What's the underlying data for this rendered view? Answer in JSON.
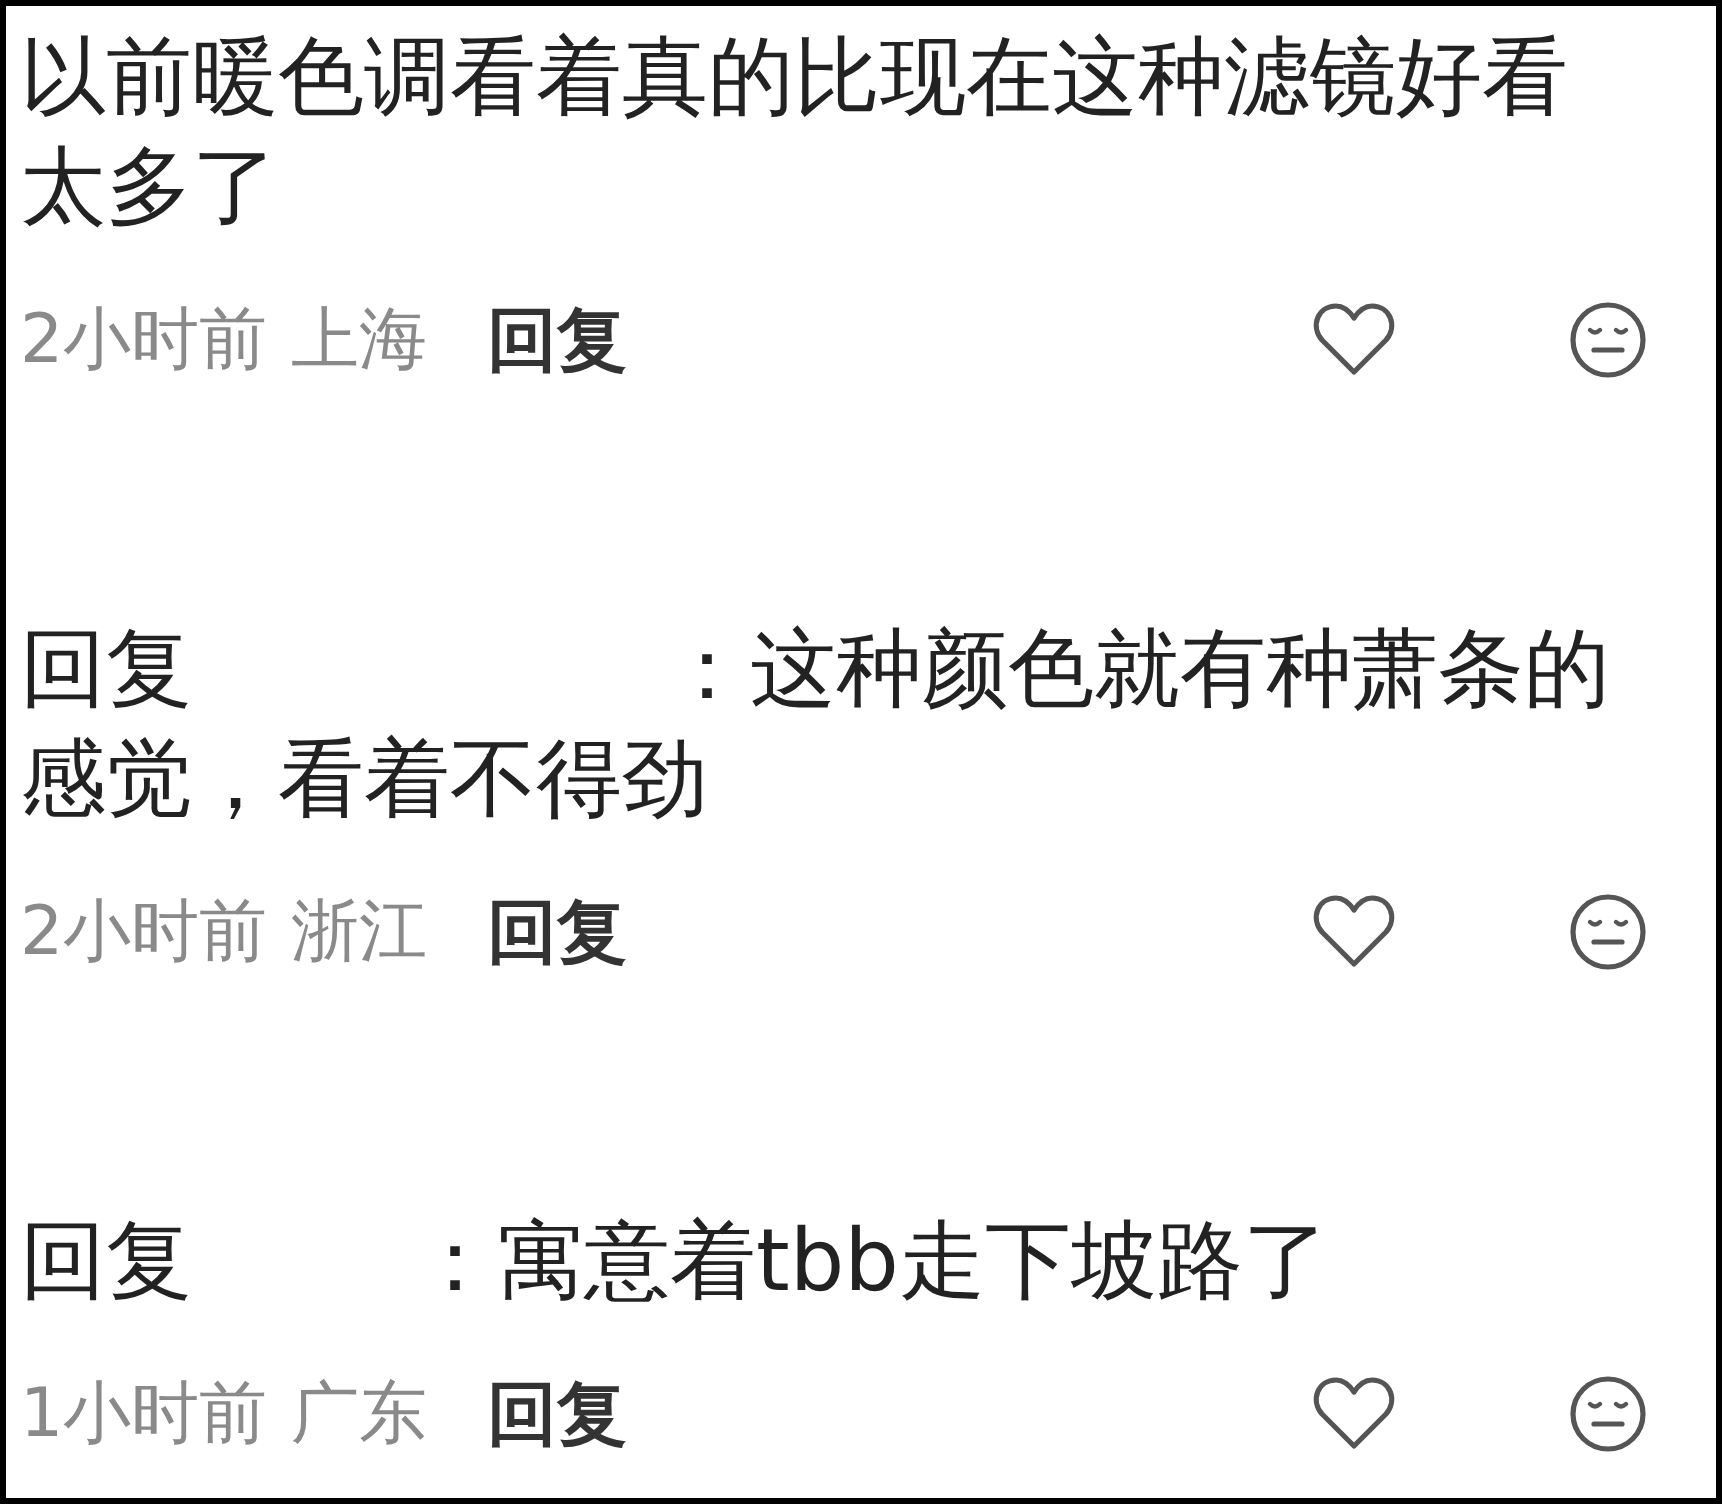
{
  "comments": [
    {
      "text": "以前暖色调看着真的比现在这种滤镜好看太多了",
      "time": "2小时前",
      "location": "上海",
      "reply": "回复"
    },
    {
      "prefix": "回复",
      "text": "：这种颜色就有种萧条的感觉，看着不得劲",
      "time": "2小时前",
      "location": "浙江",
      "reply": "回复"
    },
    {
      "prefix": "回复",
      "text": "：寓意着tbb走下坡路了",
      "time": "1小时前",
      "location": "广东",
      "reply": "回复"
    }
  ]
}
